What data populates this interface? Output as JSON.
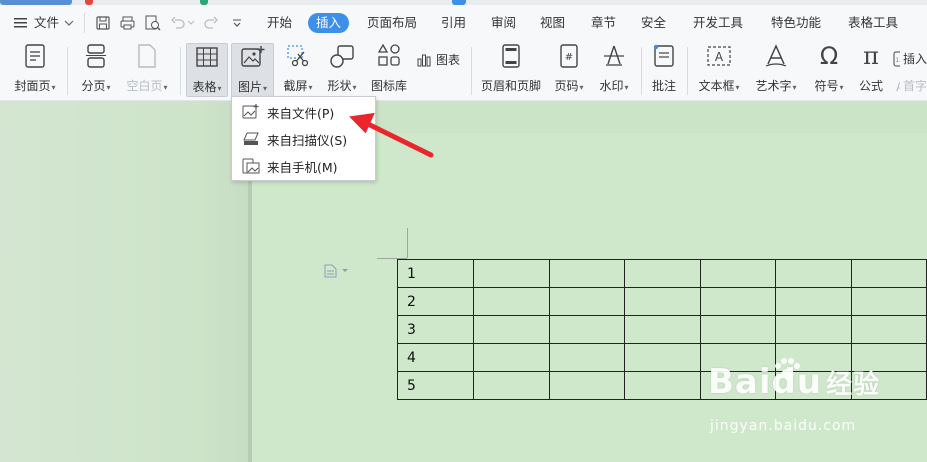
{
  "menubar": {
    "file_label": "文件",
    "tabs": [
      {
        "label": "开始"
      },
      {
        "label": "插入"
      },
      {
        "label": "页面布局"
      },
      {
        "label": "引用"
      },
      {
        "label": "审阅"
      },
      {
        "label": "视图"
      },
      {
        "label": "章节"
      },
      {
        "label": "安全"
      },
      {
        "label": "开发工具"
      },
      {
        "label": "特色功能"
      },
      {
        "label": "表格工具"
      }
    ],
    "active_tab": "插入"
  },
  "ribbon": {
    "cover_page": "封面页",
    "page_break": "分页",
    "blank_page": "空白页",
    "table": "表格",
    "picture": "图片",
    "screenshot": "截屏",
    "shapes": "形状",
    "icon_library": "图标库",
    "chart": "图表",
    "header_footer": "页眉和页脚",
    "page_number": "页码",
    "watermark": "水印",
    "comment": "批注",
    "text_box": "文本框",
    "word_art": "艺术字",
    "symbol": "符号",
    "formula": "公式",
    "insert_number": "插入",
    "drop_cap": "首字"
  },
  "picture_menu": {
    "items": [
      {
        "label": "来自文件(P)"
      },
      {
        "label": "来自扫描仪(S)"
      },
      {
        "label": "来自手机(M)"
      }
    ]
  },
  "table_rows": [
    {
      "num": "1"
    },
    {
      "num": "2"
    },
    {
      "num": "3"
    },
    {
      "num": "4"
    },
    {
      "num": "5"
    }
  ],
  "watermark": {
    "brand": "Baidu",
    "brand_suffix": "经验",
    "url": "jingyan.baidu.com"
  },
  "colors": {
    "accent": "#3d8fe8",
    "doc_background": "#cfe8cb",
    "arrow": "#e8262b"
  }
}
